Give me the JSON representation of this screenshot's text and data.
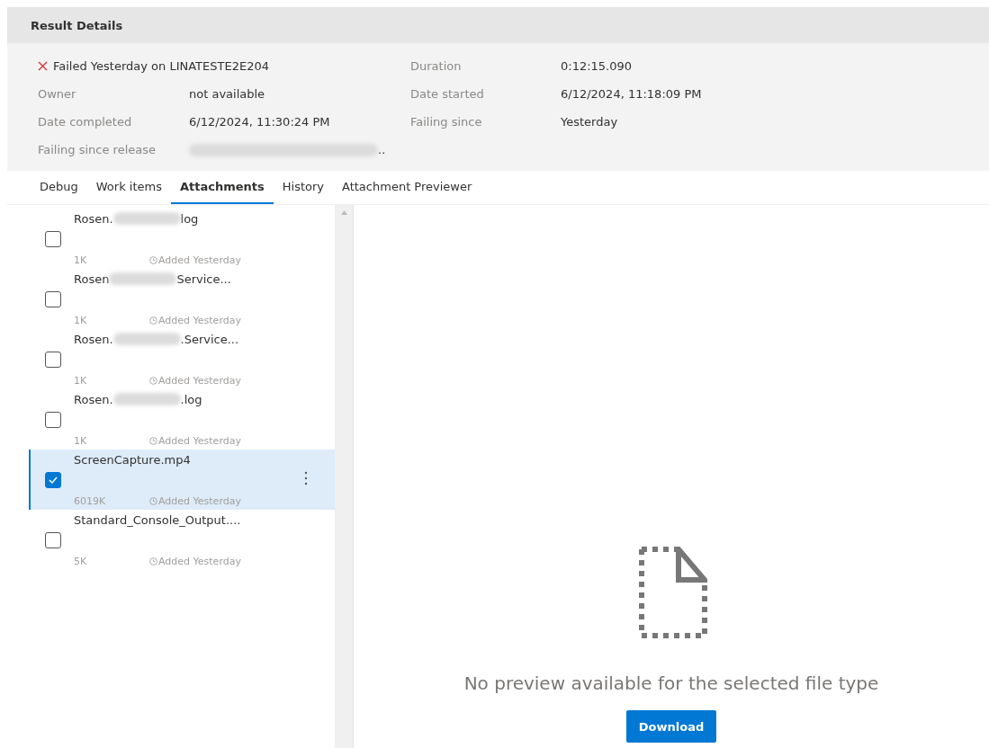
{
  "title": "Result Details",
  "summary": {
    "kind": "failed",
    "text": "Failed Yesterday on LINATESTE2E204"
  },
  "details_left": [
    {
      "label": "Owner",
      "value": "not available"
    },
    {
      "label": "Date completed",
      "value": "6/12/2024, 11:30:24 PM"
    },
    {
      "label": "Failing since release",
      "value": "..",
      "redacted": true
    }
  ],
  "details_right": [
    {
      "label": "Duration",
      "value": "0:12:15.090"
    },
    {
      "label": "Date started",
      "value": "6/12/2024, 11:18:09 PM"
    },
    {
      "label": "Failing since",
      "value": "Yesterday"
    }
  ],
  "tabs": [
    {
      "label": "Debug",
      "selected": false
    },
    {
      "label": "Work items",
      "selected": false
    },
    {
      "label": "Attachments",
      "selected": true
    },
    {
      "label": "History",
      "selected": false
    },
    {
      "label": "Attachment Previewer",
      "selected": false
    }
  ],
  "attachments": [
    {
      "name_start": "Rosen.",
      "name_end": "log",
      "redacted": true,
      "size": "1K",
      "added": "Added Yesterday",
      "checked": false,
      "selected": false
    },
    {
      "name_start": "Rosen",
      "name_end": "Service...",
      "redacted": true,
      "size": "1K",
      "added": "Added Yesterday",
      "checked": false,
      "selected": false
    },
    {
      "name_start": "Rosen.",
      "name_end": ".Service...",
      "redacted": true,
      "size": "1K",
      "added": "Added Yesterday",
      "checked": false,
      "selected": false
    },
    {
      "name_start": "Rosen.",
      "name_end": ".log",
      "redacted": true,
      "size": "1K",
      "added": "Added Yesterday",
      "checked": false,
      "selected": false
    },
    {
      "name_start": "ScreenCapture.mp4",
      "redacted": false,
      "size": "6019K",
      "added": "Added Yesterday",
      "checked": true,
      "selected": true
    },
    {
      "name_start": "Standard_Console_Output....",
      "redacted": false,
      "size": "5K",
      "added": "Added Yesterday",
      "checked": false,
      "selected": false
    }
  ],
  "preview": {
    "message": "No preview available for the selected file type",
    "button": "Download"
  }
}
